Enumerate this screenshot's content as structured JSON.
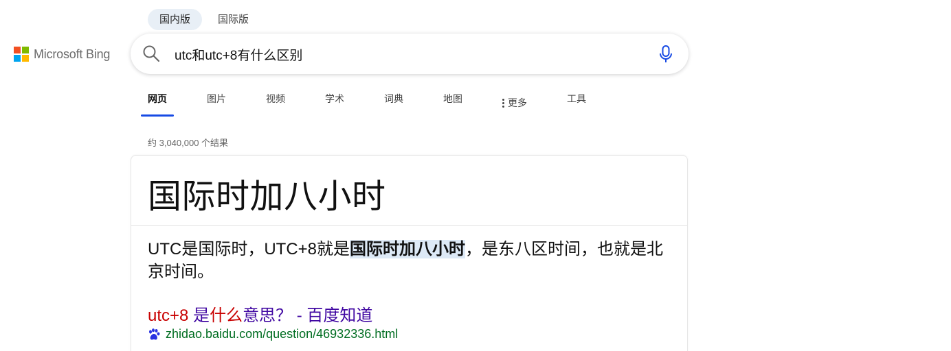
{
  "region_tabs": [
    {
      "label": "国内版"
    },
    {
      "label": "国际版"
    }
  ],
  "logo": {
    "text": "Microsoft Bing"
  },
  "search": {
    "query": "utc和utc+8有什么区别"
  },
  "nav": {
    "items": [
      {
        "label": "网页"
      },
      {
        "label": "图片"
      },
      {
        "label": "视频"
      },
      {
        "label": "学术"
      },
      {
        "label": "词典"
      },
      {
        "label": "地图"
      },
      {
        "label": "更多"
      },
      {
        "label": "工具"
      }
    ]
  },
  "results_count": "约 3,040,000 个结果",
  "answer": {
    "title": "国际时加八小时",
    "snippet_before": "UTC是国际时，UTC+8就是",
    "snippet_highlight": "国际时加八小时",
    "snippet_after": "，是东八区时间，也就是北京时间。"
  },
  "result": {
    "title_part1": "utc+8",
    "title_part2": " 是",
    "title_part3": "什么",
    "title_part4": "意思？ - 百度知道",
    "url": "zhidao.baidu.com/question/46932336.html"
  },
  "colors": {
    "accent": "#174ae4",
    "link": "#4007a2",
    "url": "#006d21",
    "highlight_bg": "#dde9f6",
    "logo_red": "#f25022",
    "logo_green": "#7fba00",
    "logo_blue": "#00a4ef",
    "logo_yellow": "#ffb900"
  }
}
